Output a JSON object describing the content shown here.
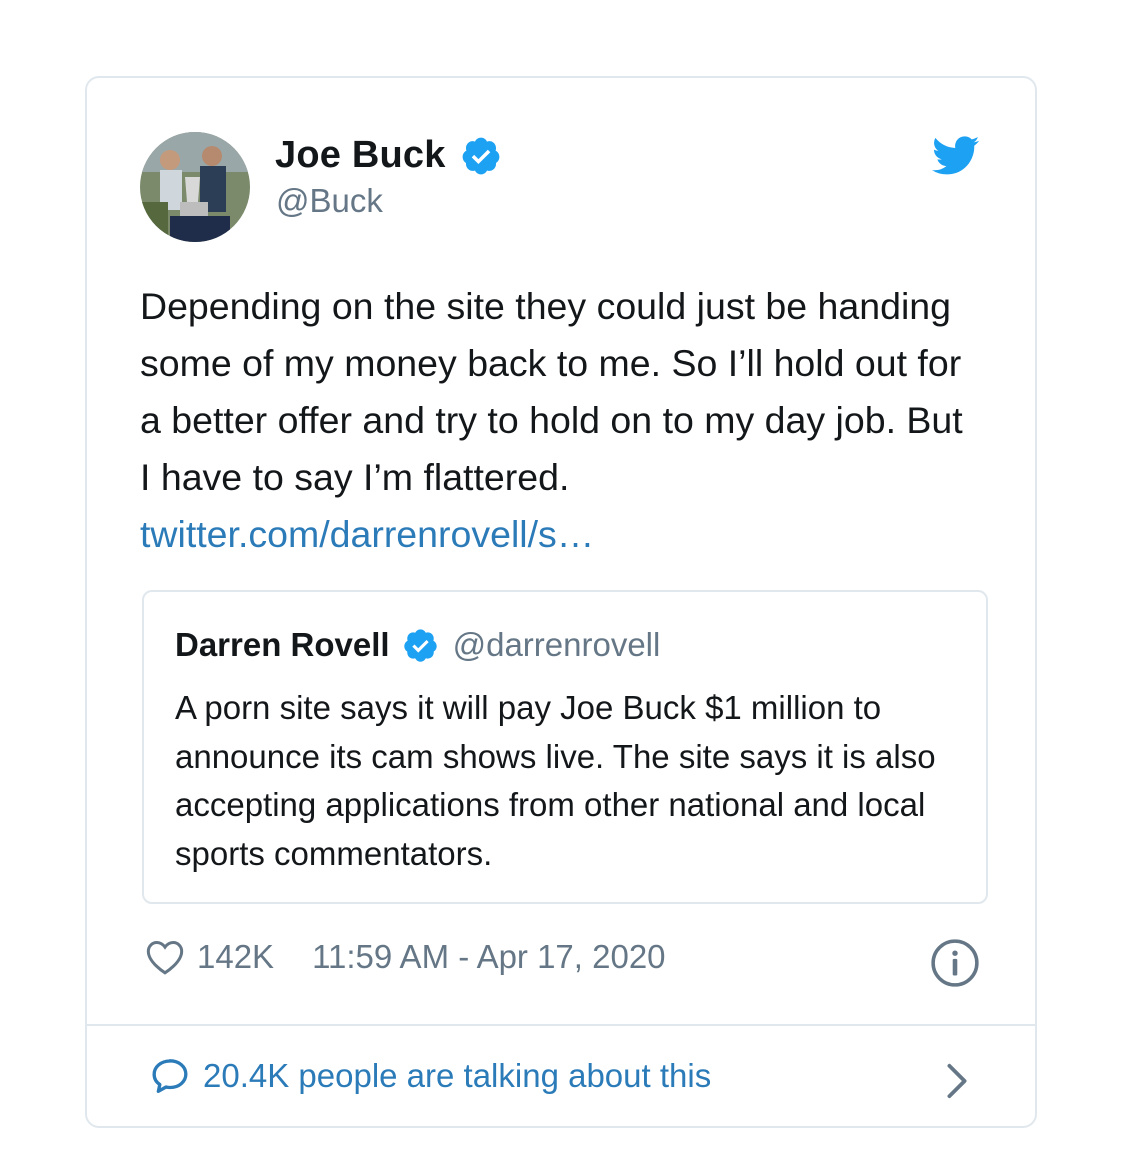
{
  "tweet": {
    "author": {
      "name": "Joe Buck",
      "handle": "@Buck",
      "verified": true,
      "avatar_icon": "avatar-photo"
    },
    "text": "Depending on the site they could just be handing some of my money back to me. So I’ll hold out for a better offer and try to hold on to my day job. But I have to say I’m flattered.",
    "link_text": "twitter.com/darrenrovell/s…",
    "quoted_tweet": {
      "author_name": "Darren Rovell",
      "author_handle": "@darrenrovell",
      "verified": true,
      "text": "A porn site says it will pay Joe Buck $1 million to announce its cam shows live. The site says it is also accepting applications from other national and local sports commentators."
    },
    "likes": "142K",
    "timestamp": "11:59 AM - Apr 17, 2020",
    "conversation_text": "20.4K people are talking about this"
  },
  "colors": {
    "text": "#14171a",
    "secondary": "#657786",
    "link": "#2b7bb9",
    "verified": "#1da1f2",
    "border": "#e1e8ed"
  },
  "icons": {
    "brand": "twitter-bird-icon",
    "verified": "verified-badge-icon",
    "like": "heart-icon",
    "info": "info-icon",
    "reply": "speech-bubble-icon",
    "more": "chevron-right-icon"
  }
}
